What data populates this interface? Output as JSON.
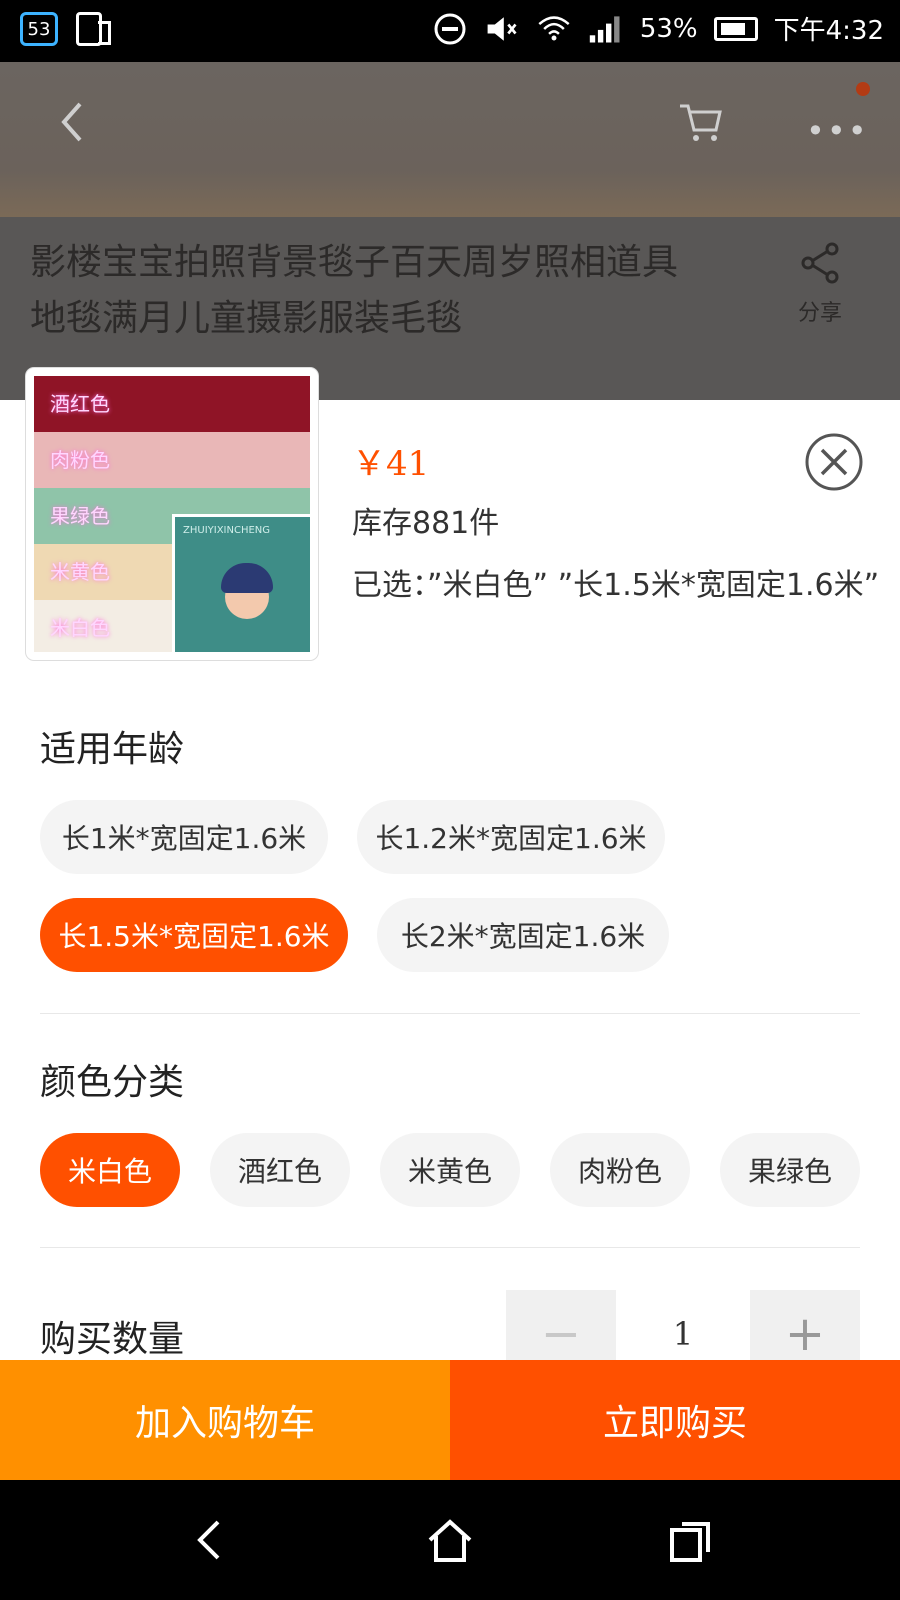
{
  "status_bar": {
    "badge": "53",
    "battery": "53%",
    "time": "下午4:32"
  },
  "header": {
    "back_icon": "chevron-left-icon",
    "cart_icon": "cart-icon",
    "more_icon": "more-icon"
  },
  "product": {
    "title": "影楼宝宝拍照背景毯子百天周岁照相道具地毯满月儿童摄影服装毛毯",
    "share_label": "分享"
  },
  "thumb": {
    "labels": [
      "酒红色",
      "肉粉色",
      "果绿色",
      "米黄色",
      "米白色"
    ],
    "brand": "ZHUIYIXINCHENG"
  },
  "sku": {
    "price": "￥41",
    "stock": "库存881件",
    "selected": "已选：”米白色” ”长1.5米*宽固定1.6米”"
  },
  "age_section": {
    "title": "适用年龄",
    "options": [
      "长1米*宽固定1.6米",
      "长1.2米*宽固定1.6米",
      "长1.5米*宽固定1.6米",
      "长2米*宽固定1.6米"
    ],
    "selected_index": 2
  },
  "color_section": {
    "title": "颜色分类",
    "options": [
      "米白色",
      "酒红色",
      "米黄色",
      "肉粉色",
      "果绿色"
    ],
    "selected_index": 0
  },
  "quantity": {
    "title": "购买数量",
    "minus": "−",
    "value": "1",
    "plus": "+"
  },
  "actions": {
    "add_to_cart": "加入购物车",
    "buy_now": "立即购买"
  },
  "colors": {
    "accent": "#ff5000",
    "cart_button": "#ff9000"
  }
}
